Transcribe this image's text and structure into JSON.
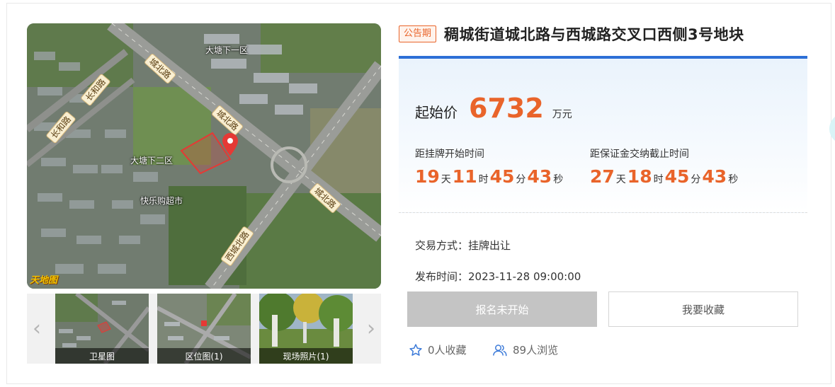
{
  "map": {
    "labels": [
      "大塘下一区",
      "大塘下二区",
      "快乐购超市"
    ],
    "roads": [
      "城北路",
      "城北路",
      "城北路",
      "长和路",
      "长和路",
      "西城北路"
    ],
    "logo": "天地图"
  },
  "thumbnails": [
    {
      "caption": "卫星图"
    },
    {
      "caption": "区位图(1)"
    },
    {
      "caption": "现场照片(1)"
    }
  ],
  "listing": {
    "status_tag": "公告期",
    "title": "稠城街道城北路与西城路交叉口西侧3号地块",
    "start_price_label": "起始价",
    "start_price_value": "6732",
    "start_price_unit": "万元",
    "countdown_listing": {
      "label": "距挂牌开始时间",
      "days": "19",
      "hours": "11",
      "minutes": "45",
      "seconds": "43"
    },
    "countdown_deposit": {
      "label": "距保证金交纳截止时间",
      "days": "27",
      "hours": "18",
      "minutes": "45",
      "seconds": "43"
    },
    "units": {
      "day": "天",
      "hour": "时",
      "minute": "分",
      "second": "秒"
    },
    "trade_method": "交易方式：挂牌出让",
    "publish_time": "发布时间：2023-11-28 09:00:00",
    "apply_button": "报名未开始",
    "favorite_button": "我要收藏",
    "favorites": "0人收藏",
    "views": "89人浏览"
  },
  "colors": {
    "accent": "#e9642a",
    "panel_top_border": "#2c6fd6",
    "disabled_button": "#c4c4c4"
  }
}
